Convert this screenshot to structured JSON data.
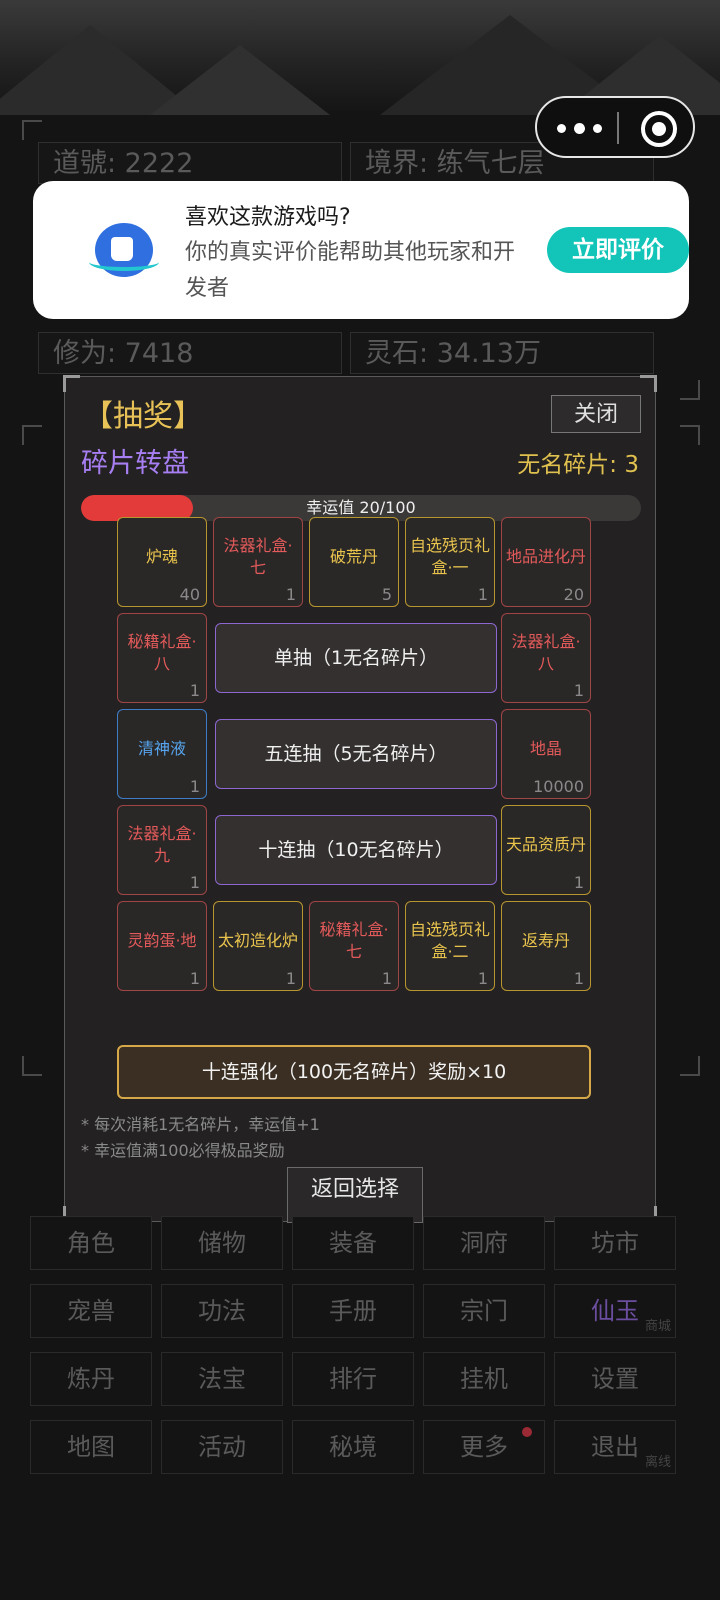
{
  "stats": {
    "dao_name": "道號: 2222",
    "realm": "境界: 练气七层",
    "cultivation": "修为: 7418",
    "spirit_stones": "灵石: 34.13万"
  },
  "rating_prompt": {
    "title": "喜欢这款游戏吗?",
    "body": "你的真实评价能帮助其他玩家和开发者",
    "button": "立即评价"
  },
  "lottery": {
    "title": "【抽奖】",
    "close_label": "关闭",
    "subtitle": "碎片转盘",
    "fragments": "无名碎片: 3",
    "luck_label": "幸运值 20/100",
    "luck_value": 20,
    "luck_max": 100,
    "prizes": [
      {
        "name": "炉魂",
        "count": "40",
        "tier": "gold"
      },
      {
        "name": "法器礼盒·七",
        "count": "1",
        "tier": "red"
      },
      {
        "name": "破荒丹",
        "count": "5",
        "tier": "gold"
      },
      {
        "name": "自选残页礼盒·一",
        "count": "1",
        "tier": "gold"
      },
      {
        "name": "地品进化丹",
        "count": "20",
        "tier": "red"
      },
      {
        "name": "秘籍礼盒·八",
        "count": "1",
        "tier": "red"
      },
      {
        "name": "法器礼盒·八",
        "count": "1",
        "tier": "red"
      },
      {
        "name": "清神液",
        "count": "1",
        "tier": "blue"
      },
      {
        "name": "地晶",
        "count": "10000",
        "tier": "red"
      },
      {
        "name": "法器礼盒·九",
        "count": "1",
        "tier": "red"
      },
      {
        "name": "天品资质丹",
        "count": "1",
        "tier": "gold"
      },
      {
        "name": "灵韵蛋·地",
        "count": "1",
        "tier": "red"
      },
      {
        "name": "太初造化炉",
        "count": "1",
        "tier": "gold"
      },
      {
        "name": "秘籍礼盒·七",
        "count": "1",
        "tier": "red"
      },
      {
        "name": "自选残页礼盒·二",
        "count": "1",
        "tier": "gold"
      },
      {
        "name": "返寿丹",
        "count": "1",
        "tier": "gold"
      }
    ],
    "single_draw": "单抽（1无名碎片）",
    "five_draw": "五连抽（5无名碎片）",
    "ten_draw": "十连抽（10无名碎片）",
    "enhance": "十连强化（100无名碎片）奖励×10",
    "note1": "* 每次消耗1无名碎片，幸运值+1",
    "note2": "* 幸运值满100必得极品奖励",
    "back_label": "返回选择"
  },
  "menu": {
    "rows": [
      [
        {
          "label": "角色"
        },
        {
          "label": "储物"
        },
        {
          "label": "装备"
        },
        {
          "label": "洞府"
        },
        {
          "label": "坊市"
        }
      ],
      [
        {
          "label": "宠兽"
        },
        {
          "label": "功法"
        },
        {
          "label": "手册"
        },
        {
          "label": "宗门"
        },
        {
          "label": "仙玉",
          "tag": "商城",
          "color": "#6c4ea0"
        }
      ],
      [
        {
          "label": "炼丹"
        },
        {
          "label": "法宝"
        },
        {
          "label": "排行"
        },
        {
          "label": "挂机"
        },
        {
          "label": "设置"
        }
      ],
      [
        {
          "label": "地图"
        },
        {
          "label": "活动"
        },
        {
          "label": "秘境"
        },
        {
          "label": "更多",
          "badge": true
        },
        {
          "label": "退出",
          "tag": "离线"
        }
      ]
    ]
  },
  "colors": {
    "accent_gold": "#e8c257",
    "accent_purple": "#a77ff2",
    "luck_red": "#e33a3a",
    "rate_button": "#12c5b8"
  }
}
